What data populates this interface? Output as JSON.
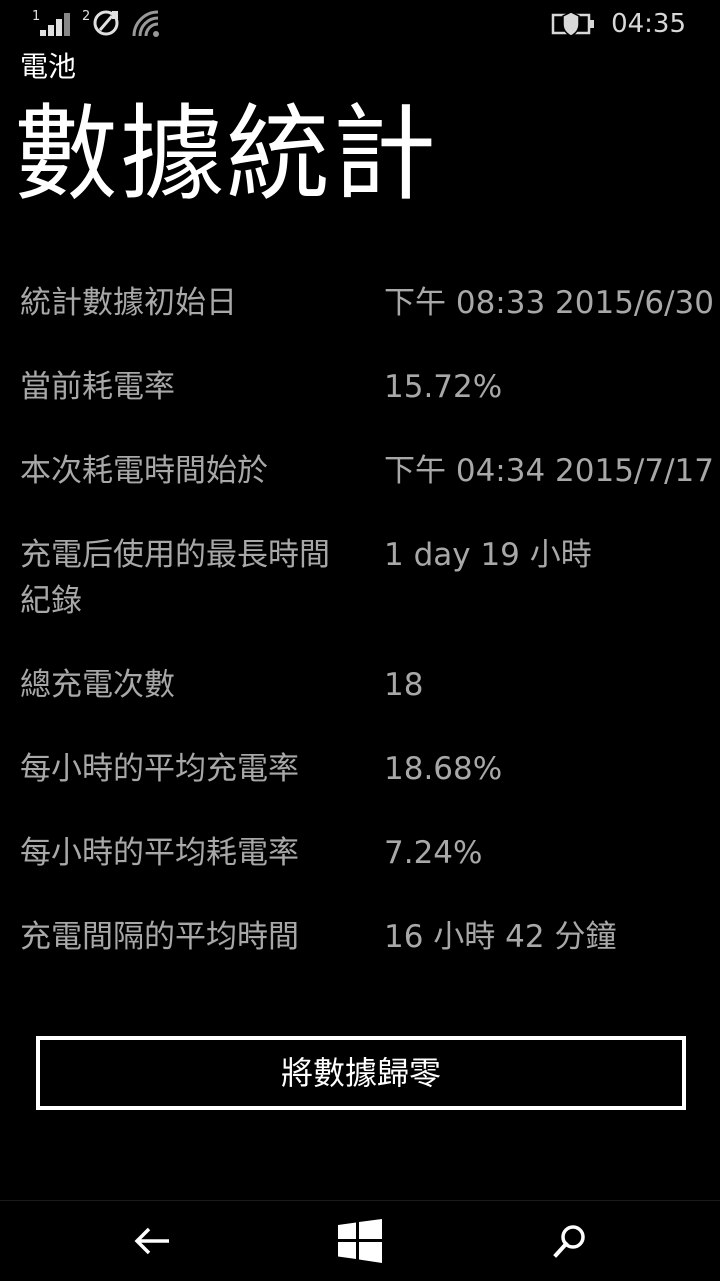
{
  "status_bar": {
    "sim1_label": "1",
    "sim2_label": "2",
    "time": "04:35",
    "icons": [
      "signal-bars-icon",
      "sim2-data-icon",
      "wifi-icon",
      "battery-saver-icon"
    ]
  },
  "header": {
    "app_title": "電池",
    "page_title": "數據統計"
  },
  "stats": [
    {
      "label": "統計數據初始日",
      "value": "下午 08:33 2015/6/30"
    },
    {
      "label": "當前耗電率",
      "value": "15.72%"
    },
    {
      "label": "本次耗電時間始於",
      "value": "下午 04:34 2015/7/17"
    },
    {
      "label": "充電后使用的最長時間紀錄",
      "value": "1 day 19 小時"
    },
    {
      "label": "總充電次數",
      "value": "18"
    },
    {
      "label": "每小時的平均充電率",
      "value": "18.68%"
    },
    {
      "label": "每小時的平均耗電率",
      "value": "7.24%"
    },
    {
      "label": "充電間隔的平均時間",
      "value": "16 小時 42 分鐘"
    }
  ],
  "actions": {
    "reset_label": "將數據歸零"
  },
  "navbar": {
    "icons": [
      "back-arrow-icon",
      "windows-start-icon",
      "search-icon"
    ]
  },
  "colors": {
    "background": "#000000",
    "text_primary": "#ffffff",
    "text_secondary": "#a8a8a8"
  }
}
